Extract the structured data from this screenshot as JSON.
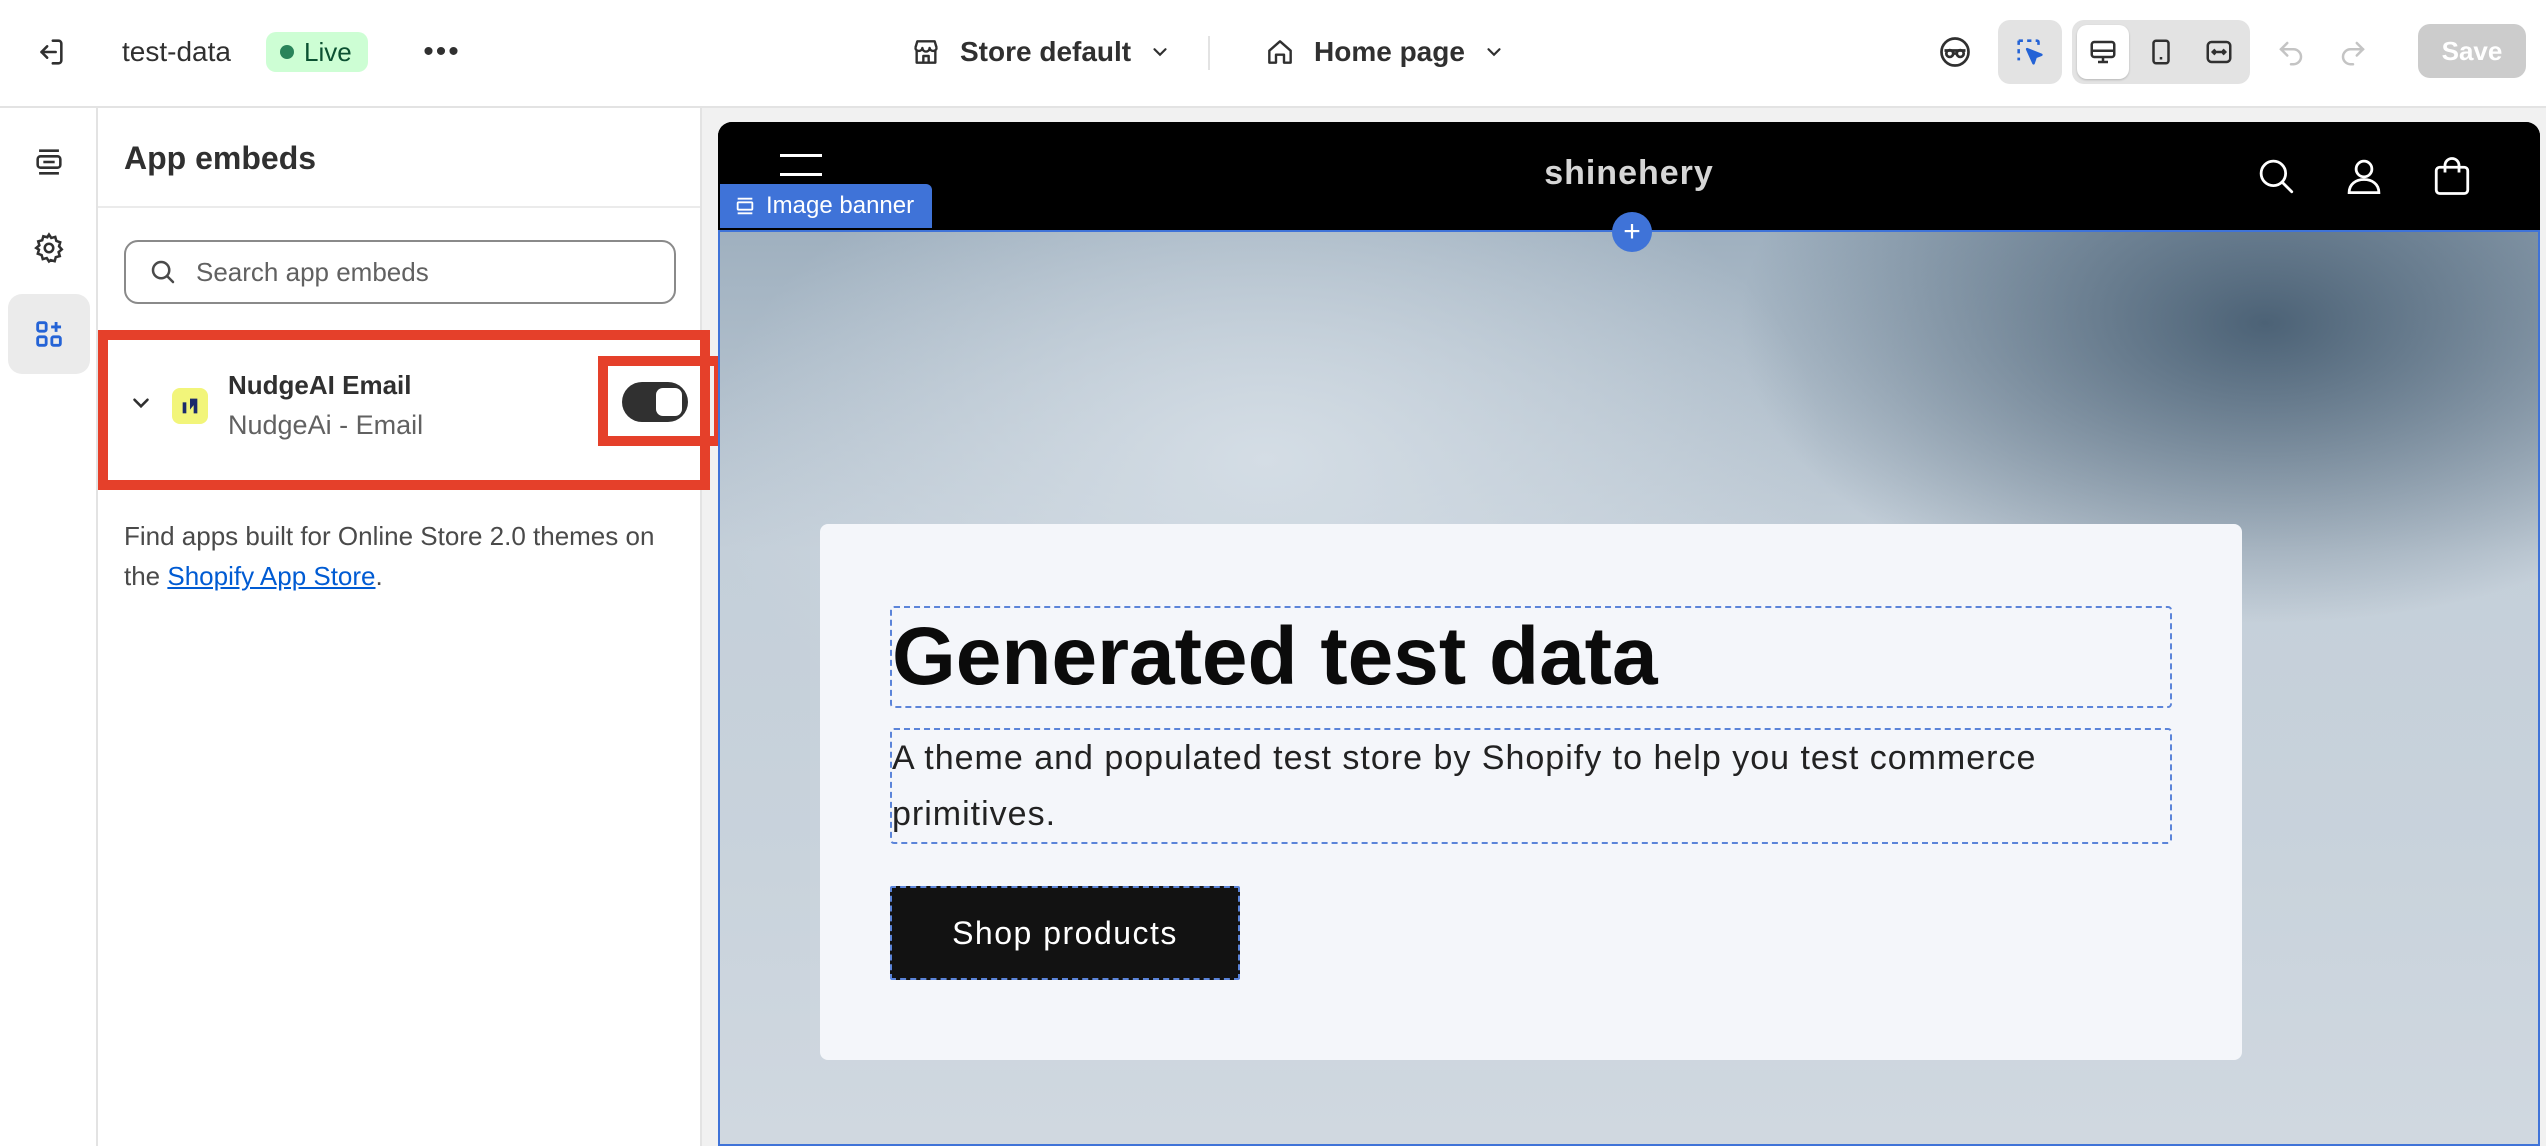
{
  "topbar": {
    "store_name": "test-data",
    "live_label": "Live",
    "more_label": "•••",
    "store_select": "Store default",
    "page_select": "Home page",
    "save_label": "Save"
  },
  "sidebar": {
    "title": "App embeds",
    "search_placeholder": "Search app embeds",
    "embed": {
      "name": "NudgeAI Email",
      "subtitle": "NudgeAi - Email",
      "enabled": true
    },
    "help_prefix": "Find apps built for Online Store 2.0 themes on the ",
    "help_link": "Shopify App Store",
    "help_suffix": "."
  },
  "preview": {
    "logo": "shinehery",
    "section_tag": "Image banner",
    "add_symbol": "+",
    "hero_title": "Generated test data",
    "hero_subtitle": "A theme and populated test store by Shopify to help you test commerce primitives.",
    "hero_button": "Shop products"
  },
  "colors": {
    "highlight_red": "#e5402a",
    "editor_blue": "#3f73d8",
    "live_green": "#cdfed4"
  },
  "icons": [
    "exit-icon",
    "store-icon",
    "home-icon",
    "chevron-down-icon",
    "inspect-icon",
    "select-cursor-icon",
    "desktop-icon",
    "mobile-icon",
    "fullwidth-icon",
    "undo-icon",
    "redo-icon",
    "sections-icon",
    "gear-icon",
    "app-embeds-icon",
    "search-icon",
    "cart-icon",
    "account-icon",
    "menu-icon"
  ]
}
